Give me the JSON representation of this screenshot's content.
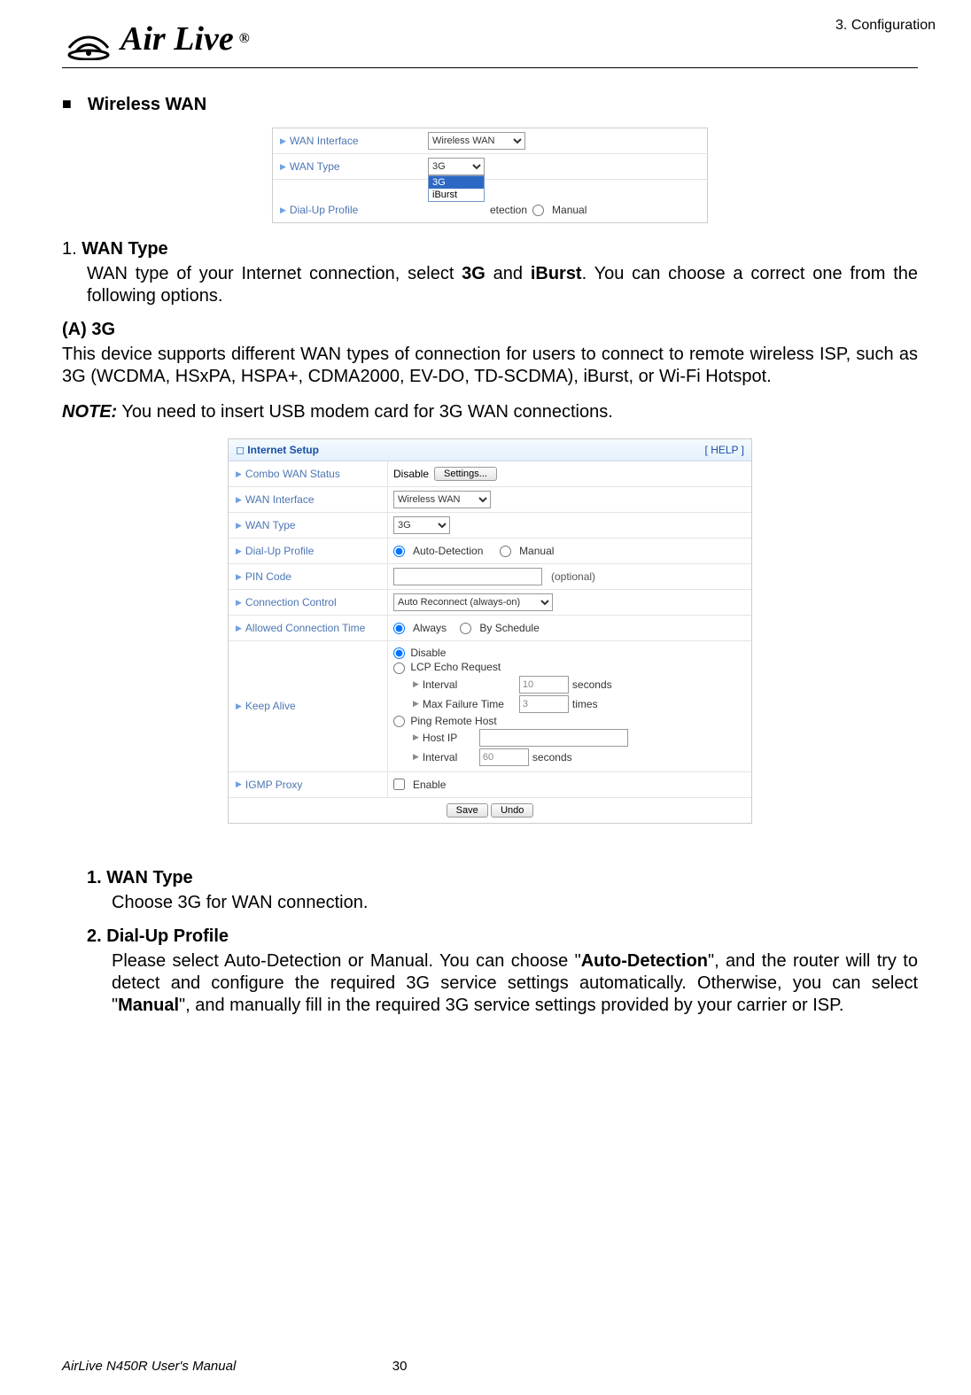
{
  "header": {
    "logo_text": "Air Live",
    "chapter": "3.  Configuration"
  },
  "section_title": "Wireless WAN",
  "panel1": {
    "rows": {
      "wan_interface_label": "WAN Interface",
      "wan_interface_value": "Wireless WAN",
      "wan_type_label": "WAN Type",
      "wan_type_value": "3G",
      "wan_type_options": {
        "opt0": "3G",
        "opt1": "iBurst"
      },
      "dialup_label": "Dial-Up Profile",
      "dialup_trailing": "etection",
      "dialup_manual": "Manual"
    }
  },
  "text1": {
    "num": "1.",
    "title": "WAN Type",
    "body_a": "WAN type of your Internet connection, select ",
    "b1": "3G",
    "body_b": " and ",
    "b2": "iBurst",
    "body_c": ".   You can choose a correct one from the following options."
  },
  "subA": {
    "label": "(A)   3G",
    "para": "This device supports different WAN types of connection for users to connect to remote wireless ISP, such as 3G (WCDMA, HSxPA, HSPA+, CDMA2000, EV-DO, TD-SCDMA), iBurst, or Wi-Fi Hotspot."
  },
  "note": {
    "label": "NOTE:",
    "text": " You need to insert USB modem card for 3G WAN connections."
  },
  "panel2": {
    "section_title": "Internet Setup",
    "help": "[ HELP ]",
    "combo_status_label": "Combo WAN Status",
    "combo_status_text": "Disable",
    "combo_status_button": "Settings...",
    "wan_interface_label": "WAN Interface",
    "wan_interface_value": "Wireless WAN",
    "wan_type_label": "WAN Type",
    "wan_type_value": "3G",
    "dialup_label": "Dial-Up Profile",
    "dialup_auto": "Auto-Detection",
    "dialup_manual": "Manual",
    "pin_label": "PIN Code",
    "pin_optional": "(optional)",
    "conn_ctrl_label": "Connection Control",
    "conn_ctrl_value": "Auto Reconnect (always-on)",
    "allowed_time_label": "Allowed Connection Time",
    "allowed_always": "Always",
    "allowed_sched": "By Schedule",
    "keepalive_label": "Keep Alive",
    "ka_disable": "Disable",
    "ka_lcp": "LCP Echo Request",
    "ka_interval_label": "Interval",
    "ka_interval_val": "10",
    "ka_interval_unit": "seconds",
    "ka_maxfail_label": "Max Failure Time",
    "ka_maxfail_val": "3",
    "ka_maxfail_unit": "times",
    "ka_ping": "Ping Remote Host",
    "ka_host_label": "Host IP",
    "ka_interval2_label": "Interval",
    "ka_interval2_val": "60",
    "ka_interval2_unit": "seconds",
    "igmp_label": "IGMP Proxy",
    "igmp_enable": "Enable",
    "save_btn": "Save",
    "undo_btn": "Undo"
  },
  "list2": {
    "item1_num": "1.",
    "item1_title": "WAN Type",
    "item1_body": "Choose 3G for WAN connection.",
    "item2_num": "2.",
    "item2_title": "Dial-Up Profile",
    "item2_body_a": "Please select Auto-Detection or Manual. You can choose \"",
    "item2_b1": "Auto-Detection",
    "item2_body_b": "\", and the router will try to detect and configure the required 3G service settings automatically. Otherwise, you can select \"",
    "item2_b2": "Manual",
    "item2_body_c": "\", and manually fill in the required 3G service settings provided by your carrier or ISP."
  },
  "footer": {
    "left": "AirLive N450R User's Manual",
    "page": "30"
  }
}
